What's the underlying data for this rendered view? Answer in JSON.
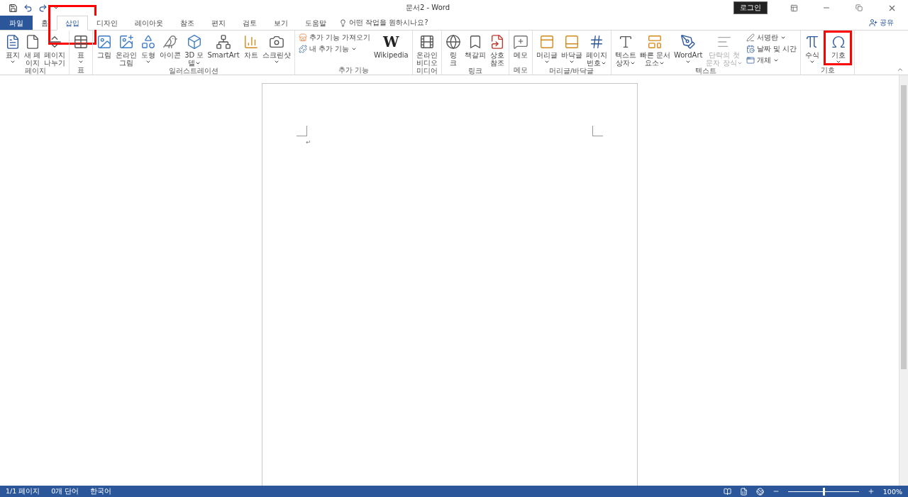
{
  "window": {
    "title": "문서2  -  Word",
    "login": "로그인"
  },
  "tabs": [
    {
      "label": "파일",
      "kind": "file",
      "selected": false,
      "highlighted": false
    },
    {
      "label": "홈",
      "kind": "tab",
      "selected": false,
      "highlighted": false
    },
    {
      "label": "삽입",
      "kind": "tab",
      "selected": true,
      "highlighted": true
    },
    {
      "label": "디자인",
      "kind": "tab",
      "selected": false,
      "highlighted": false
    },
    {
      "label": "레이아웃",
      "kind": "tab",
      "selected": false,
      "highlighted": false
    },
    {
      "label": "참조",
      "kind": "tab",
      "selected": false,
      "highlighted": false
    },
    {
      "label": "편지",
      "kind": "tab",
      "selected": false,
      "highlighted": false
    },
    {
      "label": "검토",
      "kind": "tab",
      "selected": false,
      "highlighted": false
    },
    {
      "label": "보기",
      "kind": "tab",
      "selected": false,
      "highlighted": false
    },
    {
      "label": "도움말",
      "kind": "tab",
      "selected": false,
      "highlighted": false
    }
  ],
  "tell_me": {
    "placeholder": "어떤 작업을 원하시나요?"
  },
  "share": "공유",
  "ribbon": [
    {
      "label": "페이지",
      "items": [
        {
          "kind": "large",
          "lines": [
            "표지"
          ],
          "dropdown": true
        },
        {
          "kind": "large",
          "lines": [
            "새 페",
            "이지"
          ],
          "dropdown": false
        },
        {
          "kind": "large",
          "lines": [
            "페이지",
            "나누기"
          ],
          "dropdown": false
        }
      ]
    },
    {
      "label": "표",
      "items": [
        {
          "kind": "large",
          "lines": [
            "표"
          ],
          "dropdown": true
        }
      ]
    },
    {
      "label": "일러스트레이션",
      "items": [
        {
          "kind": "large",
          "lines": [
            "그림"
          ],
          "dropdown": false
        },
        {
          "kind": "large",
          "lines": [
            "온라인",
            "그림"
          ],
          "dropdown": false
        },
        {
          "kind": "large",
          "lines": [
            "도형"
          ],
          "dropdown": true
        },
        {
          "kind": "large",
          "lines": [
            "아이콘"
          ],
          "dropdown": false
        },
        {
          "kind": "large",
          "lines": [
            "3D 모",
            "델"
          ],
          "dropdown": true
        },
        {
          "kind": "large",
          "lines": [
            "SmartArt"
          ],
          "dropdown": false
        },
        {
          "kind": "large",
          "lines": [
            "차트"
          ],
          "dropdown": false
        },
        {
          "kind": "large",
          "lines": [
            "스크린샷"
          ],
          "dropdown": true
        }
      ]
    },
    {
      "label": "추가 기능",
      "items": [
        {
          "kind": "stack",
          "entries": [
            {
              "label": "추가 기능 가져오기",
              "dropdown": false
            },
            {
              "label": "내 추가 기능",
              "dropdown": true
            }
          ]
        },
        {
          "kind": "glyph",
          "glyph": "W",
          "lines": [
            "Wikipedia"
          ],
          "dropdown": false
        }
      ]
    },
    {
      "label": "미디어",
      "items": [
        {
          "kind": "large",
          "lines": [
            "온라인",
            "비디오"
          ],
          "dropdown": false
        }
      ]
    },
    {
      "label": "링크",
      "items": [
        {
          "kind": "large",
          "lines": [
            "링",
            "크"
          ],
          "dropdown": false
        },
        {
          "kind": "large",
          "lines": [
            "책갈피"
          ],
          "dropdown": false
        },
        {
          "kind": "large",
          "lines": [
            "상호",
            "참조"
          ],
          "dropdown": false
        }
      ]
    },
    {
      "label": "메모",
      "items": [
        {
          "kind": "large",
          "lines": [
            "메모"
          ],
          "dropdown": false
        }
      ]
    },
    {
      "label": "머리글/바닥글",
      "items": [
        {
          "kind": "large",
          "lines": [
            "머리글"
          ],
          "dropdown": true
        },
        {
          "kind": "large",
          "lines": [
            "바닥글"
          ],
          "dropdown": true
        },
        {
          "kind": "large",
          "lines": [
            "페이지",
            "번호"
          ],
          "dropdown": true
        }
      ]
    },
    {
      "label": "텍스트",
      "items": [
        {
          "kind": "large",
          "lines": [
            "텍스트",
            "상자"
          ],
          "dropdown": true
        },
        {
          "kind": "large",
          "lines": [
            "빠른 문서",
            "요소"
          ],
          "dropdown": true
        },
        {
          "kind": "large",
          "lines": [
            "WordArt"
          ],
          "dropdown": true
        },
        {
          "kind": "large",
          "lines": [
            "단락의 첫",
            "문자 장식"
          ],
          "dropdown": true,
          "disabled": true
        },
        {
          "kind": "stack",
          "entries": [
            {
              "label": "서명란",
              "dropdown": true
            },
            {
              "label": "날짜 및 시간",
              "dropdown": false
            },
            {
              "label": "개체",
              "dropdown": true
            }
          ]
        }
      ]
    },
    {
      "label": "기호",
      "items": [
        {
          "kind": "large",
          "lines": [
            "수식"
          ],
          "dropdown": true
        },
        {
          "kind": "large",
          "lines": [
            "기호"
          ],
          "dropdown": true,
          "highlighted": true
        }
      ]
    }
  ],
  "document": {
    "paragraph_mark": "↵"
  },
  "status_bar": {
    "items": [
      "1/1 페이지",
      "0개 단어",
      "한국어"
    ],
    "zoom": {
      "level": 0.5,
      "reading": "100%"
    }
  }
}
